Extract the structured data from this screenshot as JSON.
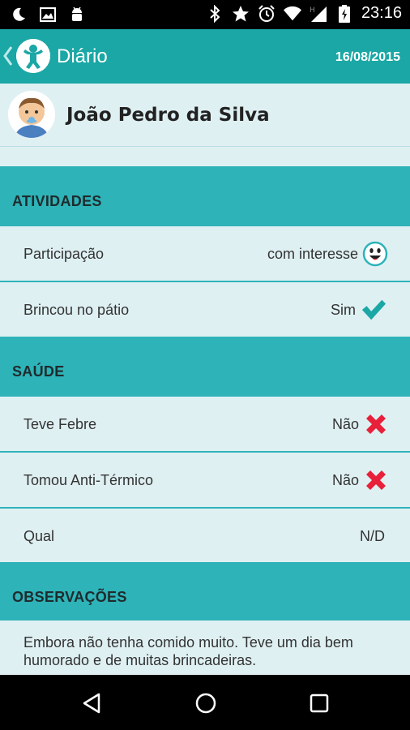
{
  "status_bar": {
    "time": "23:16",
    "icons_left": [
      "moon-icon",
      "image-icon",
      "android-icon"
    ],
    "icons_right": [
      "bluetooth-icon",
      "star-icon",
      "alarm-icon",
      "wifi-icon",
      "signal-icon",
      "battery-icon"
    ]
  },
  "appbar": {
    "title": "Diário",
    "date": "16/08/2015",
    "color": "#1aa7a5"
  },
  "profile": {
    "name": "João Pedro da Silva"
  },
  "sections": {
    "atividades": {
      "title": "ATIVIDADES",
      "rows": [
        {
          "label": "Participação",
          "value": "com interesse",
          "icon": "smiley-icon"
        },
        {
          "label": "Brincou no pátio",
          "value": "Sim",
          "icon": "check-icon"
        }
      ]
    },
    "saude": {
      "title": "SAÚDE",
      "rows": [
        {
          "label": "Teve Febre",
          "value": "Não",
          "icon": "cross-icon"
        },
        {
          "label": "Tomou Anti-Térmico",
          "value": "Não",
          "icon": "cross-icon"
        },
        {
          "label": "Qual",
          "value": "N/D"
        }
      ]
    },
    "observacoes": {
      "title": "OBSERVAÇÕES",
      "text": "Embora não tenha comido muito. Teve um dia bem humorado e de muitas brincadeiras."
    }
  },
  "colors": {
    "accent": "#2eb3b8",
    "row_bg": "#dff0f3",
    "check": "#1aa7a5",
    "cross": "#e8203a"
  },
  "navbar": {
    "buttons": [
      "back-icon",
      "home-icon",
      "recents-icon"
    ]
  }
}
